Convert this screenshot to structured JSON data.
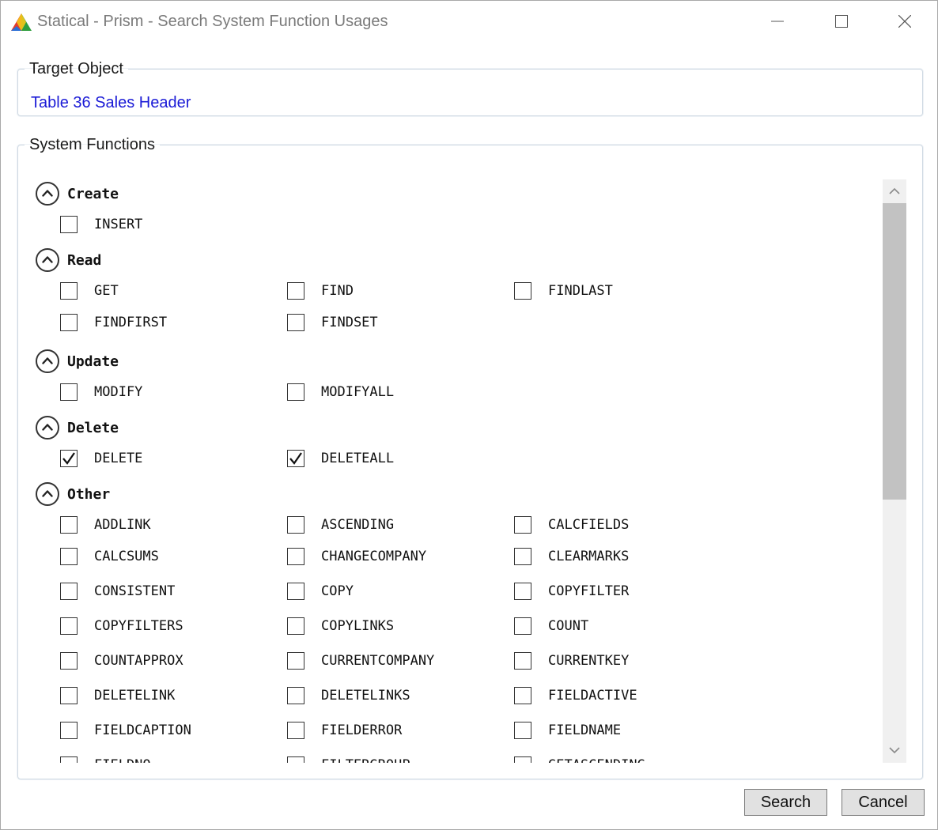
{
  "window": {
    "title": "Statical - Prism - Search System Function Usages",
    "icons": {
      "app": "prism-logo-icon",
      "minimize": "minimize-icon",
      "maximize": "maximize-icon",
      "close": "close-icon"
    }
  },
  "target_object": {
    "legend": "Target Object",
    "link_text": "Table 36 Sales Header",
    "link_color": "#1a1ad6"
  },
  "system_functions": {
    "legend": "System Functions",
    "sections": [
      {
        "name": "Create",
        "expanded": true,
        "items": [
          {
            "label": "INSERT",
            "checked": false
          }
        ]
      },
      {
        "name": "Read",
        "expanded": true,
        "items": [
          {
            "label": "GET",
            "checked": false
          },
          {
            "label": "FIND",
            "checked": false
          },
          {
            "label": "FINDLAST",
            "checked": false
          },
          {
            "label": "FINDFIRST",
            "checked": false
          },
          {
            "label": "FINDSET",
            "checked": false
          }
        ]
      },
      {
        "name": "Update",
        "expanded": true,
        "items": [
          {
            "label": "MODIFY",
            "checked": false
          },
          {
            "label": "MODIFYALL",
            "checked": false
          }
        ]
      },
      {
        "name": "Delete",
        "expanded": true,
        "items": [
          {
            "label": "DELETE",
            "checked": true
          },
          {
            "label": "DELETEALL",
            "checked": true
          }
        ]
      },
      {
        "name": "Other",
        "expanded": true,
        "items": [
          {
            "label": "ADDLINK",
            "checked": false
          },
          {
            "label": "ASCENDING",
            "checked": false
          },
          {
            "label": "CALCFIELDS",
            "checked": false
          },
          {
            "label": "CALCSUMS",
            "checked": false
          },
          {
            "label": "CHANGECOMPANY",
            "checked": false
          },
          {
            "label": "CLEARMARKS",
            "checked": false
          },
          {
            "label": "CONSISTENT",
            "checked": false
          },
          {
            "label": "COPY",
            "checked": false
          },
          {
            "label": "COPYFILTER",
            "checked": false
          },
          {
            "label": "COPYFILTERS",
            "checked": false
          },
          {
            "label": "COPYLINKS",
            "checked": false
          },
          {
            "label": "COUNT",
            "checked": false
          },
          {
            "label": "COUNTAPPROX",
            "checked": false
          },
          {
            "label": "CURRENTCOMPANY",
            "checked": false
          },
          {
            "label": "CURRENTKEY",
            "checked": false
          },
          {
            "label": "DELETELINK",
            "checked": false
          },
          {
            "label": "DELETELINKS",
            "checked": false
          },
          {
            "label": "FIELDACTIVE",
            "checked": false
          },
          {
            "label": "FIELDCAPTION",
            "checked": false
          },
          {
            "label": "FIELDERROR",
            "checked": false
          },
          {
            "label": "FIELDNAME",
            "checked": false
          },
          {
            "label": "FIELDNO",
            "checked": false
          },
          {
            "label": "FILTERGROUP",
            "checked": false
          },
          {
            "label": "GETASCENDING",
            "checked": false
          }
        ]
      }
    ],
    "scroll_position_fraction": 0.0
  },
  "buttons": {
    "search": "Search",
    "cancel": "Cancel"
  }
}
